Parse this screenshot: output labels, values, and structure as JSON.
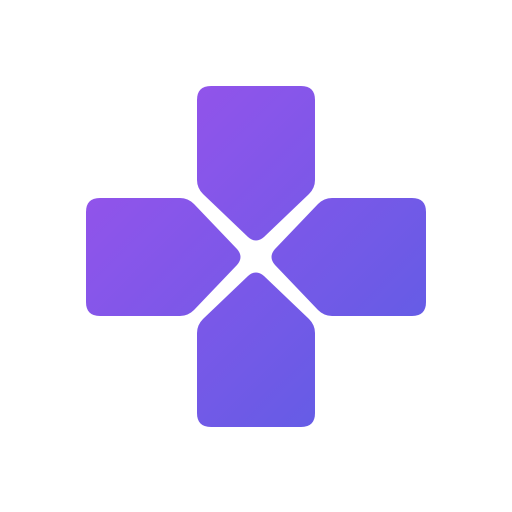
{
  "icon": {
    "name": "dpad-icon",
    "colors": {
      "background": "#ffffff",
      "gradient_start": "#9B52EC",
      "gradient_end": "#5A5EE4"
    }
  }
}
